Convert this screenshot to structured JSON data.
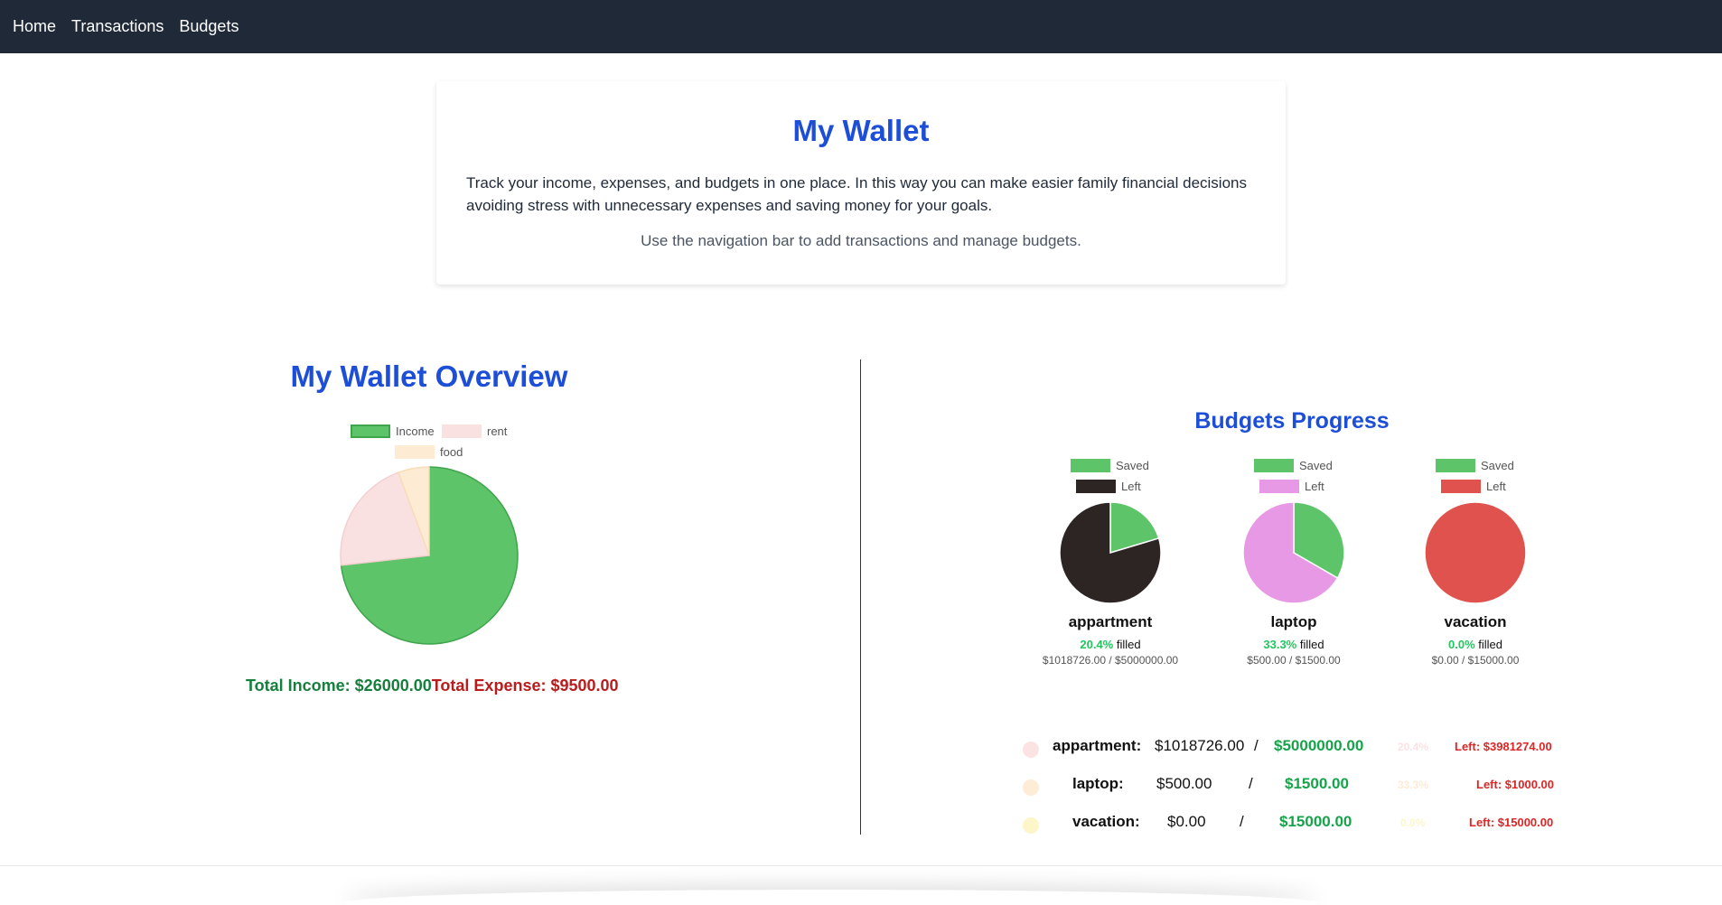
{
  "nav": {
    "items": [
      "Home",
      "Transactions",
      "Budgets"
    ]
  },
  "hero": {
    "title": "My Wallet",
    "description": "Track your income, expenses, and budgets in one place. In this way you can make easier family financial decisions avoiding stress with unnecessary expenses and saving money for your goals.",
    "hint": "Use the navigation bar to add transactions and manage budgets."
  },
  "overview": {
    "title": "My Wallet Overview",
    "total_income_label": "Total Income: $26000.00",
    "total_expense_label": "Total Expense: $9500.00"
  },
  "budgets": {
    "title": "Budgets Progress",
    "legend_saved": "Saved",
    "legend_left": "Left",
    "filled_word": "filled",
    "items": [
      {
        "name": "appartment",
        "pct": "20.4%",
        "amounts": "$1018726.00 / $5000000.00",
        "left_color": "#2d2424",
        "saved_fraction": 0.204
      },
      {
        "name": "laptop",
        "pct": "33.3%",
        "amounts": "$500.00 / $1500.00",
        "left_color": "#e899e6",
        "saved_fraction": 0.333
      },
      {
        "name": "vacation",
        "pct": "0.0%",
        "amounts": "$0.00 / $15000.00",
        "left_color": "#e0524d",
        "saved_fraction": 0.0
      }
    ],
    "summary": [
      {
        "name": "appartment:",
        "saved": "$1018726.00",
        "slash": "/",
        "target": "$5000000.00",
        "pct": "20.4%",
        "left": "Left: $3981274.00",
        "dot_color": "#fbe3e3"
      },
      {
        "name": "laptop:",
        "saved": "$500.00",
        "slash": "/",
        "target": "$1500.00",
        "pct": "33.3%",
        "left": "Left: $1000.00",
        "dot_color": "#fdecd6"
      },
      {
        "name": "vacation:",
        "saved": "$0.00",
        "slash": "/",
        "target": "$15000.00",
        "pct": "0.0%",
        "left": "Left: $15000.00",
        "dot_color": "#fdf6c9"
      }
    ]
  },
  "chart_data": [
    {
      "type": "pie",
      "title": "",
      "labels": [
        "Income",
        "rent",
        "food"
      ],
      "values": [
        26000,
        7500,
        2000
      ],
      "colors": [
        "#5ec46a",
        "#f9e1e1",
        "#fdebd3"
      ]
    },
    {
      "type": "pie",
      "title": "appartment",
      "labels": [
        "Saved",
        "Left"
      ],
      "values": [
        1018726,
        3981274
      ],
      "colors": [
        "#5ec46a",
        "#2d2424"
      ]
    },
    {
      "type": "pie",
      "title": "laptop",
      "labels": [
        "Saved",
        "Left"
      ],
      "values": [
        500,
        1000
      ],
      "colors": [
        "#5ec46a",
        "#e899e6"
      ]
    },
    {
      "type": "pie",
      "title": "vacation",
      "labels": [
        "Saved",
        "Left"
      ],
      "values": [
        0,
        15000
      ],
      "colors": [
        "#5ec46a",
        "#e0524d"
      ]
    }
  ]
}
